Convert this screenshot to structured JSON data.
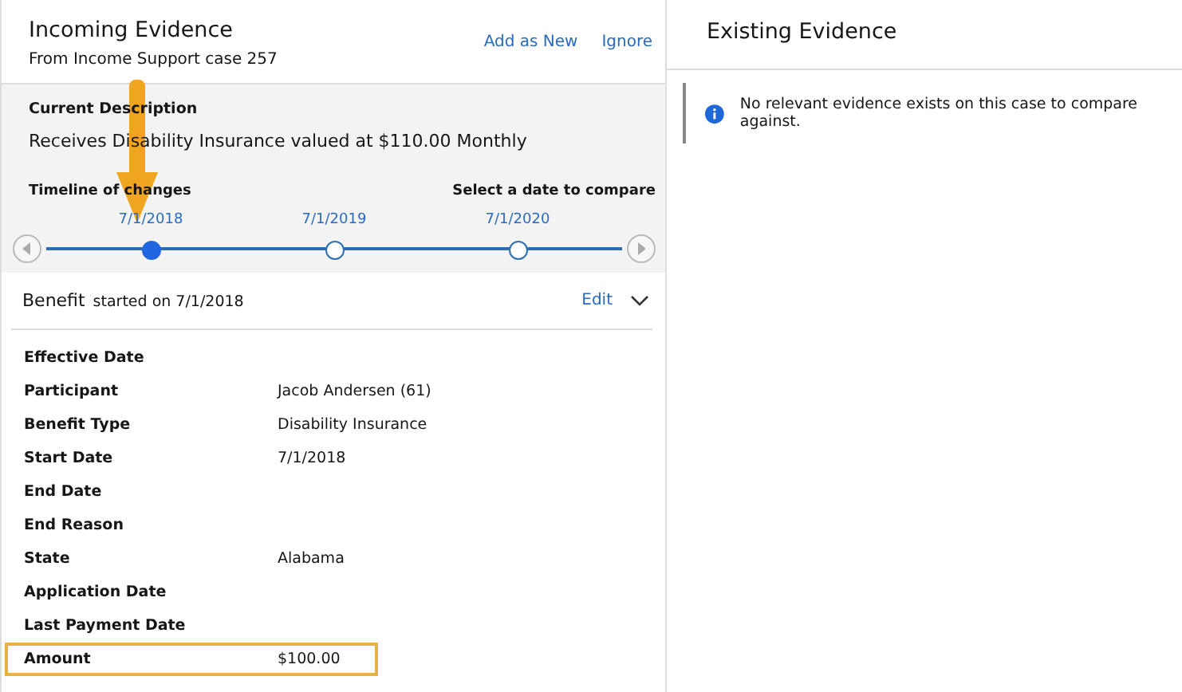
{
  "incoming": {
    "title": "Incoming Evidence",
    "subtitle": "From Income Support case 257",
    "actions": [
      "Add as New",
      "Ignore"
    ],
    "description_label": "Current Description",
    "description": "Receives Disability Insurance valued at $110.00 Monthly",
    "timeline_label": "Timeline of changes",
    "compare_label": "Select a date to compare",
    "timeline": [
      {
        "date": "7/1/2018",
        "selected": true
      },
      {
        "date": "7/1/2019",
        "selected": false
      },
      {
        "date": "7/1/2020",
        "selected": false
      }
    ],
    "benefit": {
      "title": "Benefit",
      "started": "started on 7/1/2018",
      "edit": "Edit",
      "expanded": true,
      "fields": [
        {
          "label": "Effective Date",
          "highlighted": false
        },
        {
          "label": "Participant",
          "value": "Jacob Andersen (61)",
          "highlighted": false
        },
        {
          "label": "Benefit Type",
          "value": "Disability Insurance",
          "highlighted": false
        },
        {
          "label": "Start Date",
          "value": "7/1/2018",
          "highlighted": false
        },
        {
          "label": "End Date",
          "highlighted": false
        },
        {
          "label": "End Reason",
          "highlighted": false
        },
        {
          "label": "State",
          "value": "Alabama",
          "highlighted": false
        },
        {
          "label": "Application Date",
          "highlighted": false
        },
        {
          "label": "Last Payment Date",
          "highlighted": false
        },
        {
          "label": "Amount",
          "value": "$100.00",
          "highlighted": true
        }
      ]
    }
  },
  "existing": {
    "title": "Existing Evidence",
    "notice": "No relevant evidence exists on this case to compare against."
  }
}
